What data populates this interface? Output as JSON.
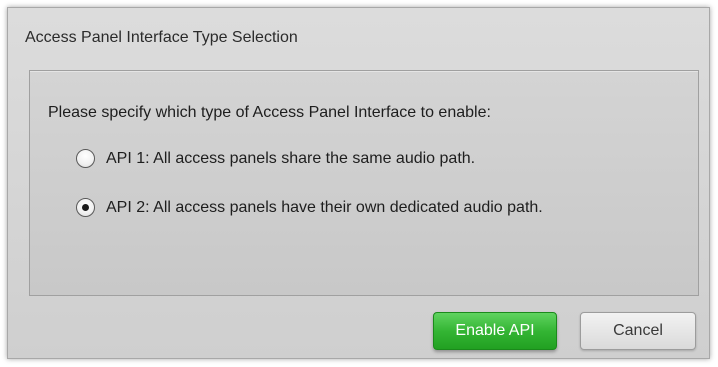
{
  "dialog": {
    "title": "Access Panel Interface Type Selection",
    "prompt": "Please specify which type of Access Panel Interface to enable:",
    "options": [
      {
        "label": "API 1: All access panels share the same audio path.",
        "selected": false
      },
      {
        "label": "API 2: All access panels have their own dedicated audio path.",
        "selected": true
      }
    ],
    "buttons": {
      "enable_label": "Enable API",
      "cancel_label": "Cancel"
    }
  },
  "colors": {
    "primary_button": "#34b534",
    "dialog_background": "#d4d4d4"
  }
}
